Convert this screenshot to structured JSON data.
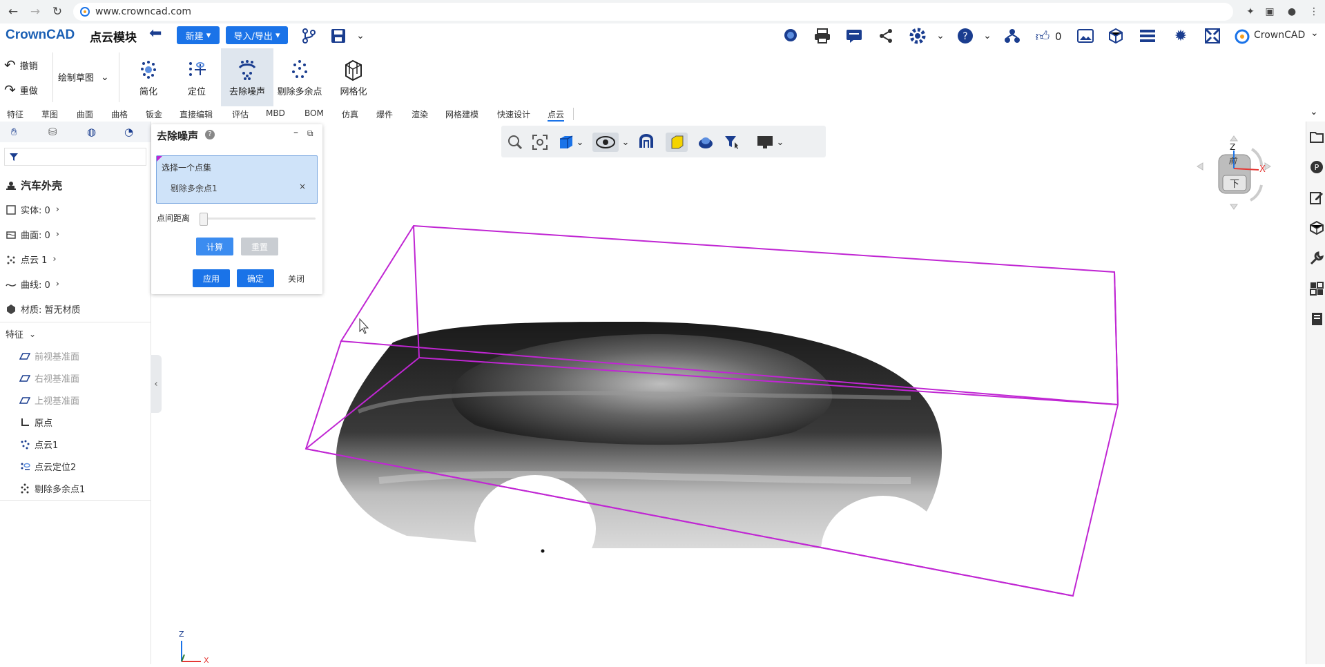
{
  "browser": {
    "url": "www.crowncad.com"
  },
  "header": {
    "brand": "CrownCAD",
    "module_title": "点云模块",
    "new_label": "新建",
    "import_export_label": "导入/导出",
    "like_count": "0",
    "account_label": "CrownCAD"
  },
  "ribbon": {
    "undo_label": "撤销",
    "redo_label": "重做",
    "sketch_select": "绘制草图",
    "buttons": [
      {
        "label": "简化",
        "icon": "simplify-icon"
      },
      {
        "label": "定位",
        "icon": "locate-icon"
      },
      {
        "label": "去除噪声",
        "icon": "denoise-icon"
      },
      {
        "label": "剔除多余点",
        "icon": "remove-points-icon"
      },
      {
        "label": "网格化",
        "icon": "mesh-icon"
      }
    ]
  },
  "tabs": [
    "特征",
    "草图",
    "曲面",
    "曲格",
    "钣金",
    "直接编辑",
    "评估",
    "MBD",
    "BOM",
    "仿真",
    "爆件",
    "渲染",
    "网格建模",
    "快速设计",
    "点云"
  ],
  "tree": {
    "root": "汽车外壳",
    "solids": "实体: 0",
    "surfaces": "曲面: 0",
    "pointclouds": "点云 1",
    "curves": "曲线: 0",
    "material": "材质:  暂无材质",
    "features_header": "特征",
    "features": [
      "前视基准面",
      "右视基准面",
      "上视基准面",
      "原点",
      "点云1",
      "点云定位2",
      "剔除多余点1"
    ]
  },
  "dialog": {
    "title": "去除噪声",
    "select_label": "选择一个点集",
    "selected_item": "剔除多余点1",
    "distance_label": "点间距离",
    "distance_value": 0,
    "compute_label": "计算",
    "reset_label": "重置",
    "apply_label": "应用",
    "ok_label": "确定",
    "close_label": "关闭"
  },
  "viewcube": {
    "z_label": "Z",
    "x_label": "X",
    "front_label": "前",
    "bottom_label": "下"
  },
  "triad": {
    "z_label": "Z",
    "x_label": "X"
  },
  "colors": {
    "accent": "#1a73e8",
    "bbox": "#c026d3",
    "selection_bg": "#cfe3f9"
  }
}
